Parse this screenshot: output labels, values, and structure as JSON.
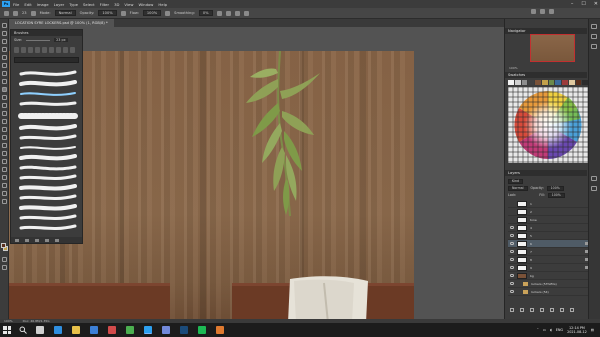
{
  "menubar": {
    "app_logo": "Ps",
    "items": [
      "File",
      "Edit",
      "Image",
      "Layer",
      "Type",
      "Select",
      "Filter",
      "3D",
      "View",
      "Window",
      "Help"
    ],
    "window_controls": [
      "–",
      "☐",
      "✕"
    ]
  },
  "options": {
    "size_value": "23",
    "mode_label": "Mode:",
    "mode_value": "Normal",
    "opacity_label": "Opacity:",
    "opacity_value": "100%",
    "flow_label": "Flow:",
    "flow_value": "100%",
    "smoothing_label": "Smoothing:",
    "smoothing_value": "0%"
  },
  "document": {
    "tab_title": "LOCATION SYRE LOCKERS.psd @ 100% (1, RGB/8) *"
  },
  "brushes": {
    "title": "Brushes",
    "size_label": "Size:",
    "size_value": "23 px",
    "search_placeholder": "",
    "preset_numbers": [
      "25",
      "15",
      "30",
      "35",
      "60",
      "40",
      "40"
    ]
  },
  "navigator": {
    "title": "Navigator",
    "zoom": "100%"
  },
  "swatches": {
    "title": "Swatches",
    "recent": [
      "#f2f2f2",
      "#cfcfcf",
      "#8d8d8d",
      "#404040",
      "#7a5238",
      "#c2a14b",
      "#6b8a4a",
      "#3b6a9a",
      "#9b3b3b",
      "#e0c9a0",
      "#5a2f1c",
      "#2b2b2b"
    ]
  },
  "layers": {
    "title": "Layers",
    "kind_label": "Kind",
    "blend_mode": "Normal",
    "opacity_label": "Opacity:",
    "opacity_value": "100%",
    "lock_label": "Lock:",
    "fill_label": "Fill:",
    "fill_value": "100%",
    "items": [
      {
        "name": "1",
        "thumb": "white",
        "selected": false,
        "visible": false,
        "locked": false
      },
      {
        "name": "2",
        "thumb": "white",
        "selected": false,
        "visible": false,
        "locked": false
      },
      {
        "name": "tone",
        "thumb": "white",
        "selected": false,
        "visible": false,
        "locked": false
      },
      {
        "name": "4",
        "thumb": "white",
        "selected": false,
        "visible": true,
        "locked": false
      },
      {
        "name": "5",
        "thumb": "white",
        "selected": false,
        "visible": true,
        "locked": false
      },
      {
        "name": "6",
        "thumb": "white",
        "selected": true,
        "visible": true,
        "locked": true
      },
      {
        "name": "7",
        "thumb": "white",
        "selected": false,
        "visible": true,
        "locked": true
      },
      {
        "name": "8",
        "thumb": "white",
        "selected": false,
        "visible": true,
        "locked": true
      },
      {
        "name": "9",
        "thumb": "white",
        "selected": false,
        "visible": true,
        "locked": true
      },
      {
        "name": "bg",
        "thumb": "brown",
        "selected": false,
        "visible": true,
        "locked": false
      },
      {
        "name": "lockers (53%fills)",
        "thumb": "folder",
        "selected": false,
        "visible": true,
        "locked": false
      },
      {
        "name": "lockers (54)",
        "thumb": "folder",
        "selected": false,
        "visible": true,
        "locked": false
      }
    ]
  },
  "statusbar": {
    "zoom": "100%",
    "doc_info": "Doc: 46.8M/1.35G"
  },
  "taskbar": {
    "search_icon": "search-icon",
    "apps": [
      {
        "name": "task-view",
        "color": "#d0d0d0"
      },
      {
        "name": "edge",
        "color": "#2f8fe0"
      },
      {
        "name": "file-explorer",
        "color": "#e8c14a"
      },
      {
        "name": "mail",
        "color": "#3c7fd6"
      },
      {
        "name": "media",
        "color": "#d24b4b"
      },
      {
        "name": "chrome",
        "color": "#4caf50"
      },
      {
        "name": "photoshop",
        "color": "#2da0f0"
      },
      {
        "name": "discord",
        "color": "#7289da"
      },
      {
        "name": "steam",
        "color": "#1b4b7a"
      },
      {
        "name": "spotify",
        "color": "#1db954"
      },
      {
        "name": "app",
        "color": "#e07a30"
      }
    ],
    "time": "12:14 PM",
    "date": "2021-08-12",
    "language": "ENG"
  },
  "colors": {
    "foreground": "#5a2f1c",
    "background": "#c2a14b"
  }
}
